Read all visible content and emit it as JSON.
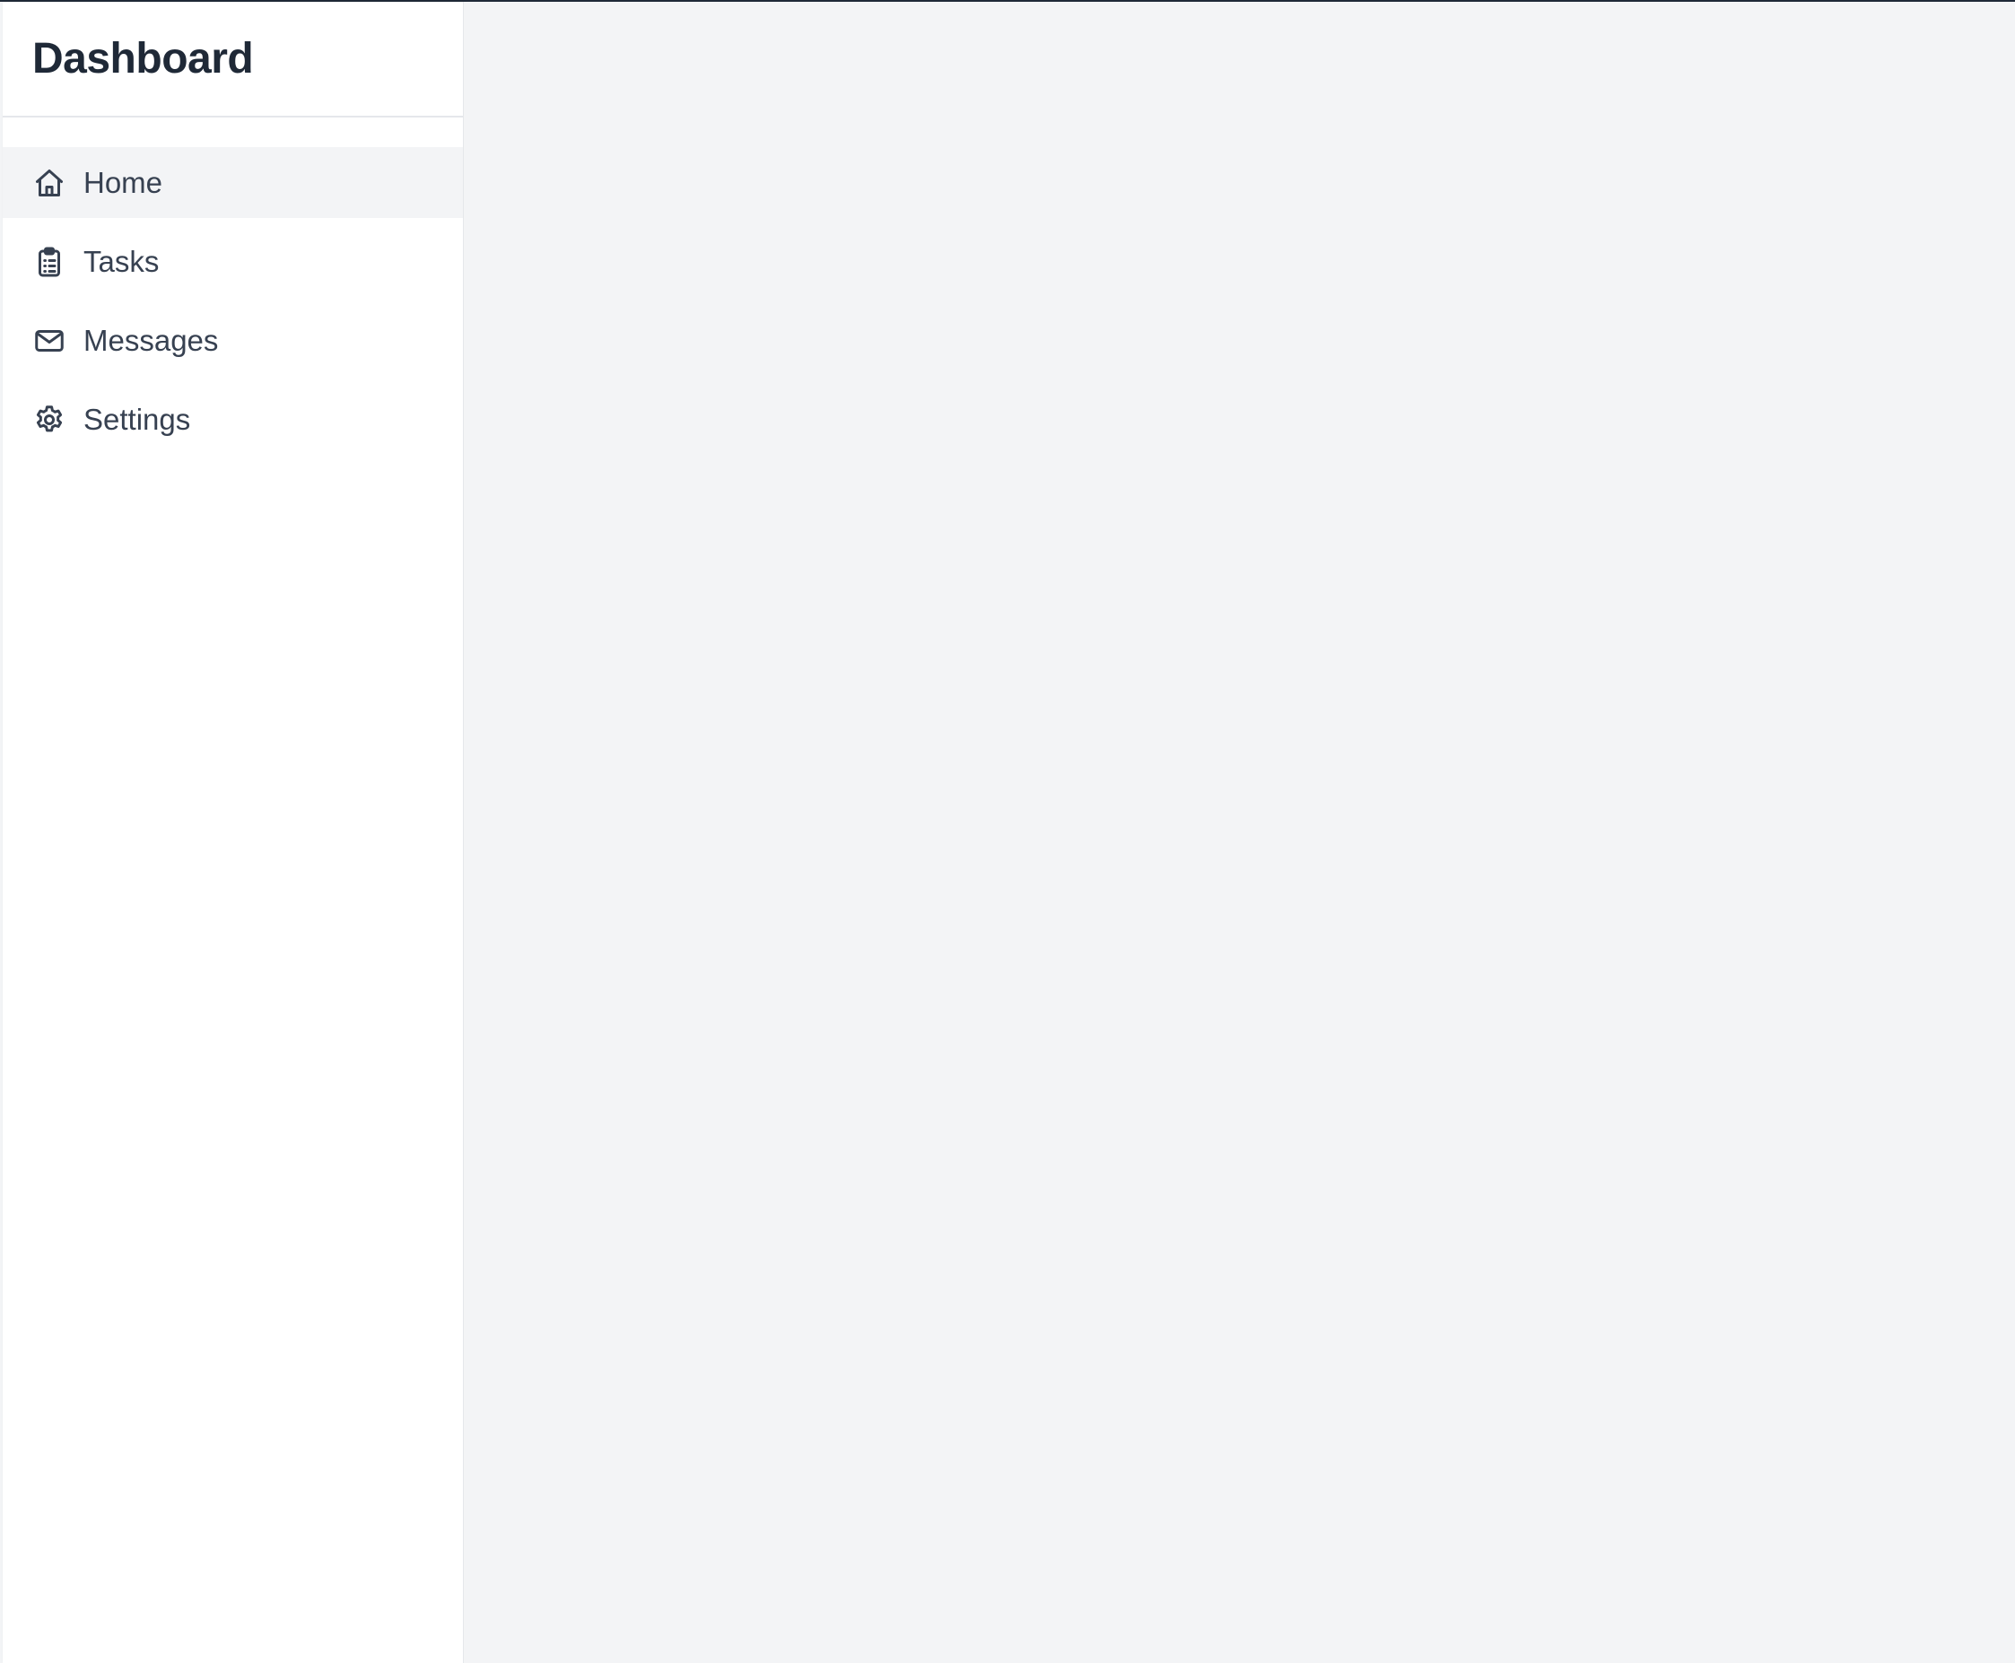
{
  "app": {
    "title": "Dashboard"
  },
  "sidebar": {
    "items": [
      {
        "label": "Home",
        "icon": "home-icon",
        "active": true
      },
      {
        "label": "Tasks",
        "icon": "clipboard-icon",
        "active": false
      },
      {
        "label": "Messages",
        "icon": "mail-icon",
        "active": false
      },
      {
        "label": "Settings",
        "icon": "gear-icon",
        "active": false
      }
    ]
  },
  "colors": {
    "sidebar_bg": "#ffffff",
    "main_bg": "#f3f4f6",
    "active_item_bg": "#f3f4f6",
    "title_text": "#1f2937",
    "nav_text": "#374151",
    "divider": "#e5e7eb"
  }
}
